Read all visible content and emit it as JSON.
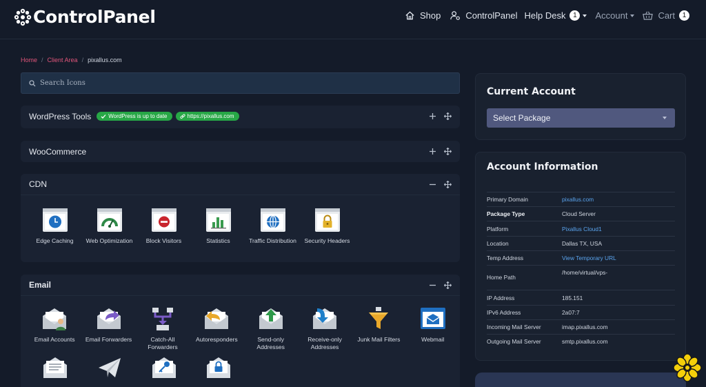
{
  "header": {
    "brand": "ControlPanel",
    "nav": {
      "shop": "Shop",
      "controlpanel": "ControlPanel",
      "helpdesk": "Help Desk",
      "helpdesk_count": "1",
      "account": "Account",
      "cart": "Cart",
      "cart_count": "1"
    }
  },
  "breadcrumb": {
    "home": "Home",
    "client_area": "Client Area",
    "current": "pixallus.com"
  },
  "search": {
    "placeholder": "Search Icons"
  },
  "panels": {
    "wordpress": {
      "title": "WordPress Tools",
      "status_badge": "WordPress is up to date",
      "url_badge": "https://pixallus.com"
    },
    "woocommerce": {
      "title": "WooCommerce"
    },
    "cdn": {
      "title": "CDN",
      "tiles": [
        "Edge Caching",
        "Web Optimization",
        "Block Visitors",
        "Statistics",
        "Traffic Distribution",
        "Security Headers"
      ]
    },
    "email": {
      "title": "Email",
      "tiles": [
        "Email Accounts",
        "Email Forwarders",
        "Catch-All Forwarders",
        "Autoresponders",
        "Send-only Addresses",
        "Receive-only Addresses",
        "Junk Mail Filters",
        "Webmail"
      ]
    }
  },
  "current_account": {
    "title": "Current Account",
    "select_label": "Select Package"
  },
  "account_info": {
    "title": "Account Information",
    "rows": [
      {
        "label": "Primary Domain",
        "value": "pixallus.com"
      },
      {
        "label": "Package Type",
        "value": "Cloud Server"
      },
      {
        "label": "Platform",
        "value": "Pixallus Cloud1"
      },
      {
        "label": "Location",
        "value": "Dallas TX, USA"
      },
      {
        "label": "Temp Address",
        "value": "View Temporary URL"
      },
      {
        "label": "Home Path",
        "value": "/home/virtual/vps-"
      },
      {
        "label": "IP Address",
        "value": "185.151"
      },
      {
        "label": "IPv6 Address",
        "value": "2a07:7"
      },
      {
        "label": "Incoming Mail Server",
        "value": "imap.pixallus.com"
      },
      {
        "label": "Outgoing Mail Server",
        "value": "smtp.pixallus.com"
      }
    ]
  },
  "colors": {
    "accent_link": "#5aa4ee",
    "breadcrumb_link": "#e0557a",
    "badge_green": "#27a746",
    "select_bg": "#50587e",
    "background": "#141b29"
  }
}
